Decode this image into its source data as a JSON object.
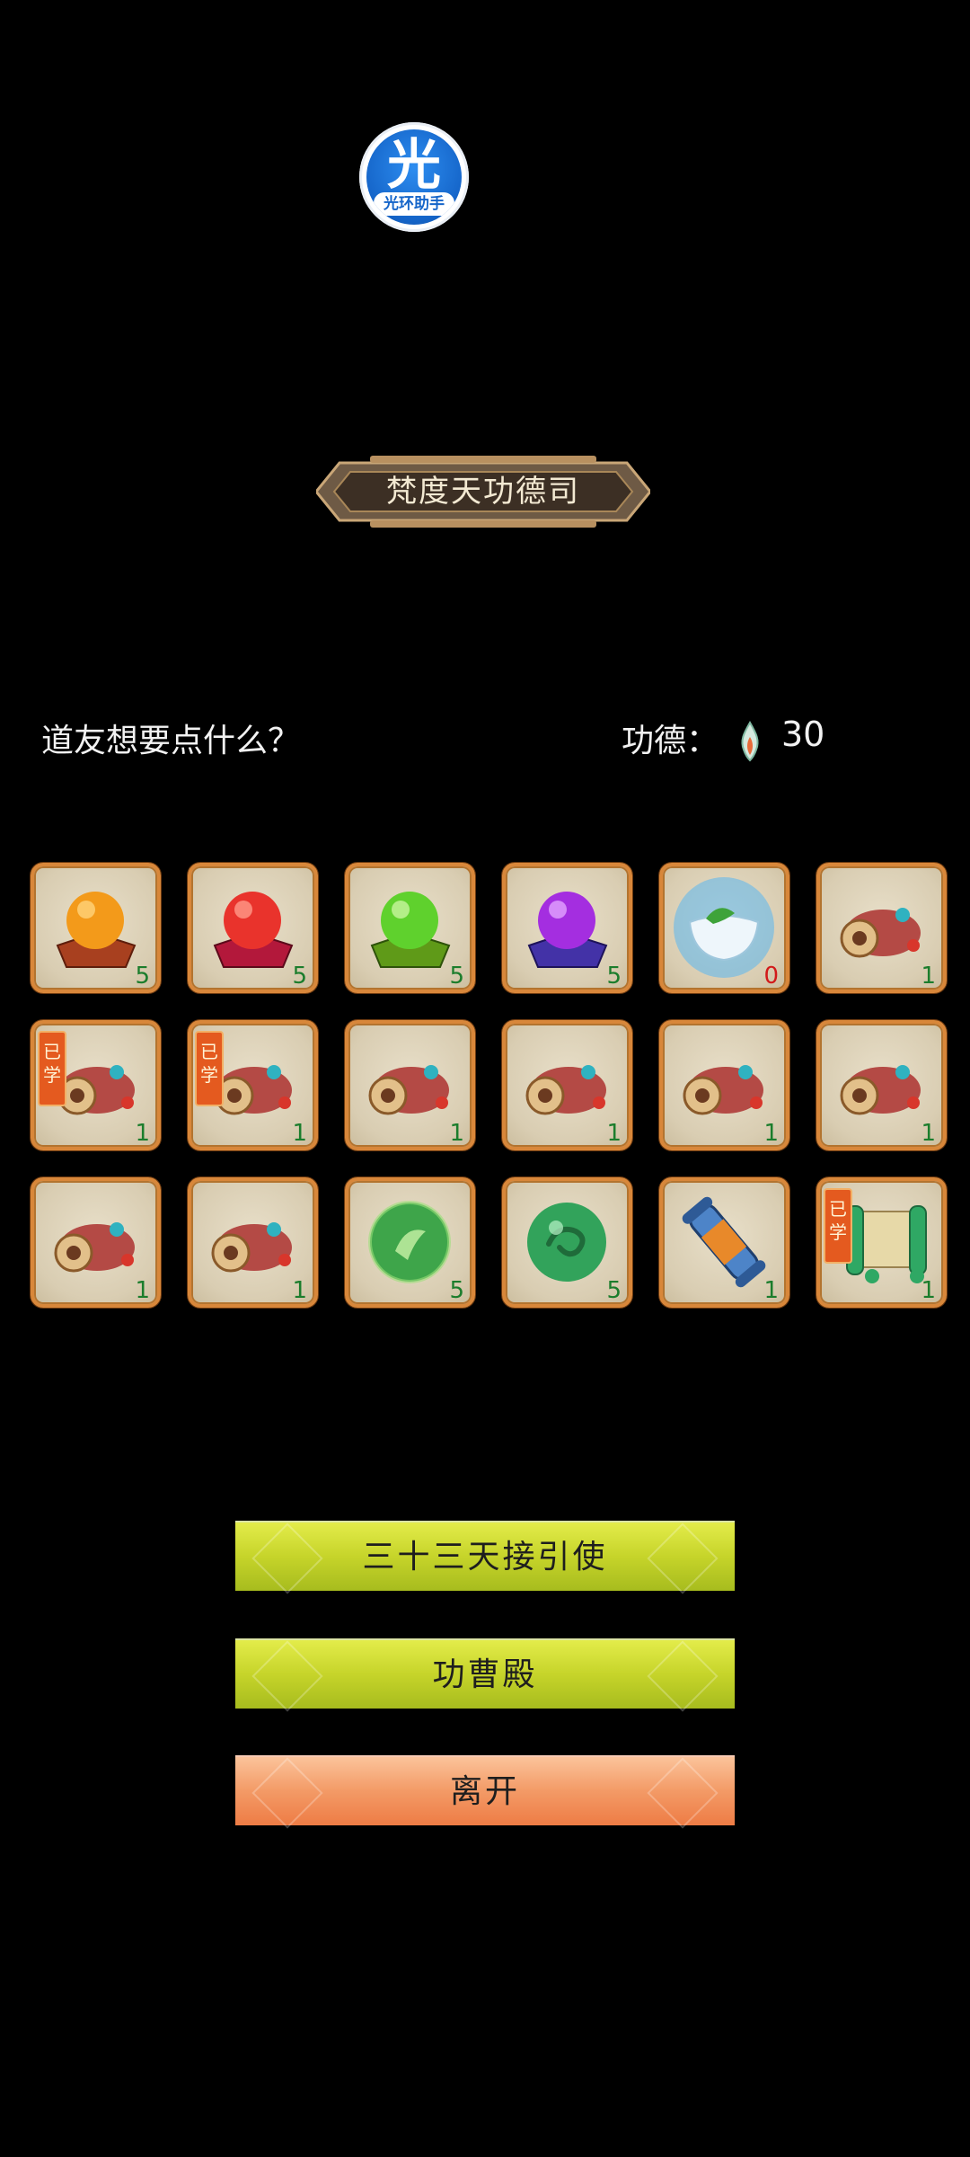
{
  "assistant": {
    "glyph": "光",
    "caption": "光环助手"
  },
  "title": "梵度天功德司",
  "prompt": "道友想要点什么？",
  "merit": {
    "label": "功德：",
    "value": "30",
    "icon": "merit-flame-icon"
  },
  "items": [
    {
      "icon": "orange-orb-pedestal-icon",
      "qty": "5"
    },
    {
      "icon": "red-orb-pedestal-icon",
      "qty": "5"
    },
    {
      "icon": "green-orb-pedestal-icon",
      "qty": "5"
    },
    {
      "icon": "purple-orb-pedestal-icon",
      "qty": "5"
    },
    {
      "icon": "tea-bowl-icon",
      "qty": "0"
    },
    {
      "icon": "ornate-scroll-icon",
      "qty": "1"
    },
    {
      "icon": "ornate-scroll-icon",
      "qty": "1",
      "badge": "已学"
    },
    {
      "icon": "ornate-scroll-icon",
      "qty": "1",
      "badge": "已学"
    },
    {
      "icon": "ornate-scroll-icon",
      "qty": "1"
    },
    {
      "icon": "ornate-scroll-icon",
      "qty": "1"
    },
    {
      "icon": "ornate-scroll-icon",
      "qty": "1"
    },
    {
      "icon": "ornate-scroll-icon",
      "qty": "1"
    },
    {
      "icon": "ornate-scroll-icon",
      "qty": "1"
    },
    {
      "icon": "ornate-scroll-icon",
      "qty": "1"
    },
    {
      "icon": "green-leaf-orb-icon",
      "qty": "5"
    },
    {
      "icon": "green-swirl-orb-icon",
      "qty": "5"
    },
    {
      "icon": "blue-scroll-icon",
      "qty": "1"
    },
    {
      "icon": "green-open-scroll-icon",
      "qty": "1",
      "badge": "已学"
    }
  ],
  "buttons": {
    "guide": "三十三天接引使",
    "hall": "功曹殿",
    "leave": "离开"
  }
}
